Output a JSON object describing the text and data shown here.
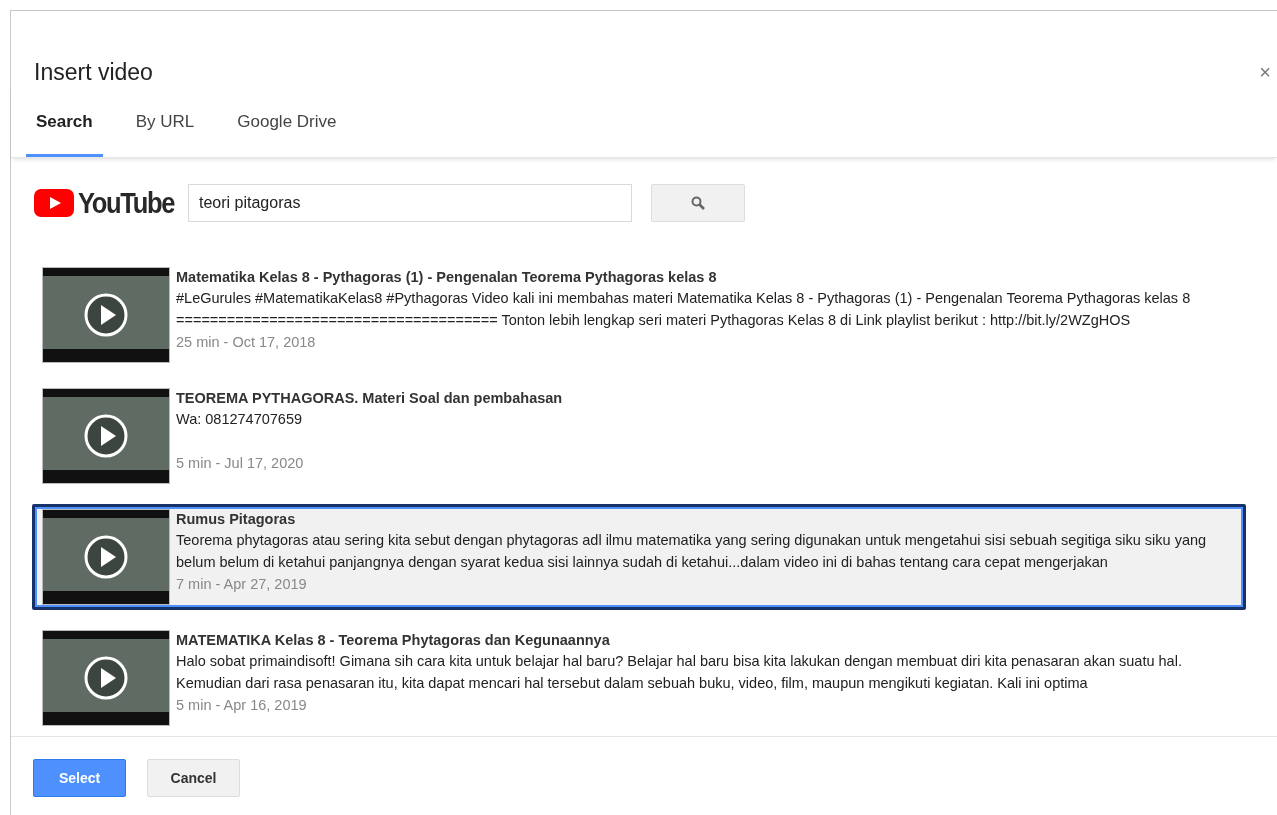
{
  "dialog": {
    "title": "Insert video",
    "close": "×"
  },
  "tabs": [
    {
      "label": "Search",
      "selected": true
    },
    {
      "label": "By URL",
      "selected": false
    },
    {
      "label": "Google Drive",
      "selected": false
    }
  ],
  "search": {
    "logo_text": "YouTube",
    "value": "teori pitagoras"
  },
  "results": [
    {
      "title": "Matematika Kelas 8 - Pythagoras (1) - Pengenalan Teorema Pythagoras kelas 8",
      "description": "#LeGurules #MatematikaKelas8 #Pythagoras Video kali ini membahas materi Matematika Kelas 8 - Pythagoras (1) - Pengenalan Teorema Pythagoras kelas 8 ====================================== Tonton lebih lengkap seri materi Pythagoras Kelas 8 di Link playlist berikut : http://bit.ly/2WZgHOS",
      "meta": "25 min - Oct 17, 2018",
      "selected": false
    },
    {
      "title": "TEOREMA PYTHAGORAS. Materi Soal dan pembahasan",
      "description": "Wa: 081274707659",
      "meta": "5 min - Jul 17, 2020",
      "selected": false
    },
    {
      "title": "Rumus Pitagoras",
      "description": "Teorema phytagoras atau sering kita sebut dengan phytagoras adl ilmu matematika yang sering digunakan untuk mengetahui sisi sebuah segitiga siku siku yang belum belum di ketahui panjangnya dengan syarat kedua sisi lainnya sudah di ketahui...dalam video ini di bahas tentang cara cepat mengerjakan",
      "meta": "7 min - Apr 27, 2019",
      "selected": true
    },
    {
      "title": "MATEMATIKA Kelas 8 - Teorema Phytagoras dan Kegunaannya",
      "description": "Halo sobat primaindisoft! Gimana sih cara kita untuk belajar hal baru? Belajar hal baru bisa kita lakukan dengan membuat diri kita penasaran akan suatu hal. Kemudian dari rasa penasaran itu, kita dapat mencari hal tersebut dalam sebuah buku, video, film, maupun mengikuti kegiatan. Kali ini optima",
      "meta": "5 min - Apr 16, 2019",
      "selected": false
    }
  ],
  "buttons": [
    {
      "label": "Select",
      "kind": "primary"
    },
    {
      "label": "Cancel",
      "kind": "secondary"
    }
  ]
}
